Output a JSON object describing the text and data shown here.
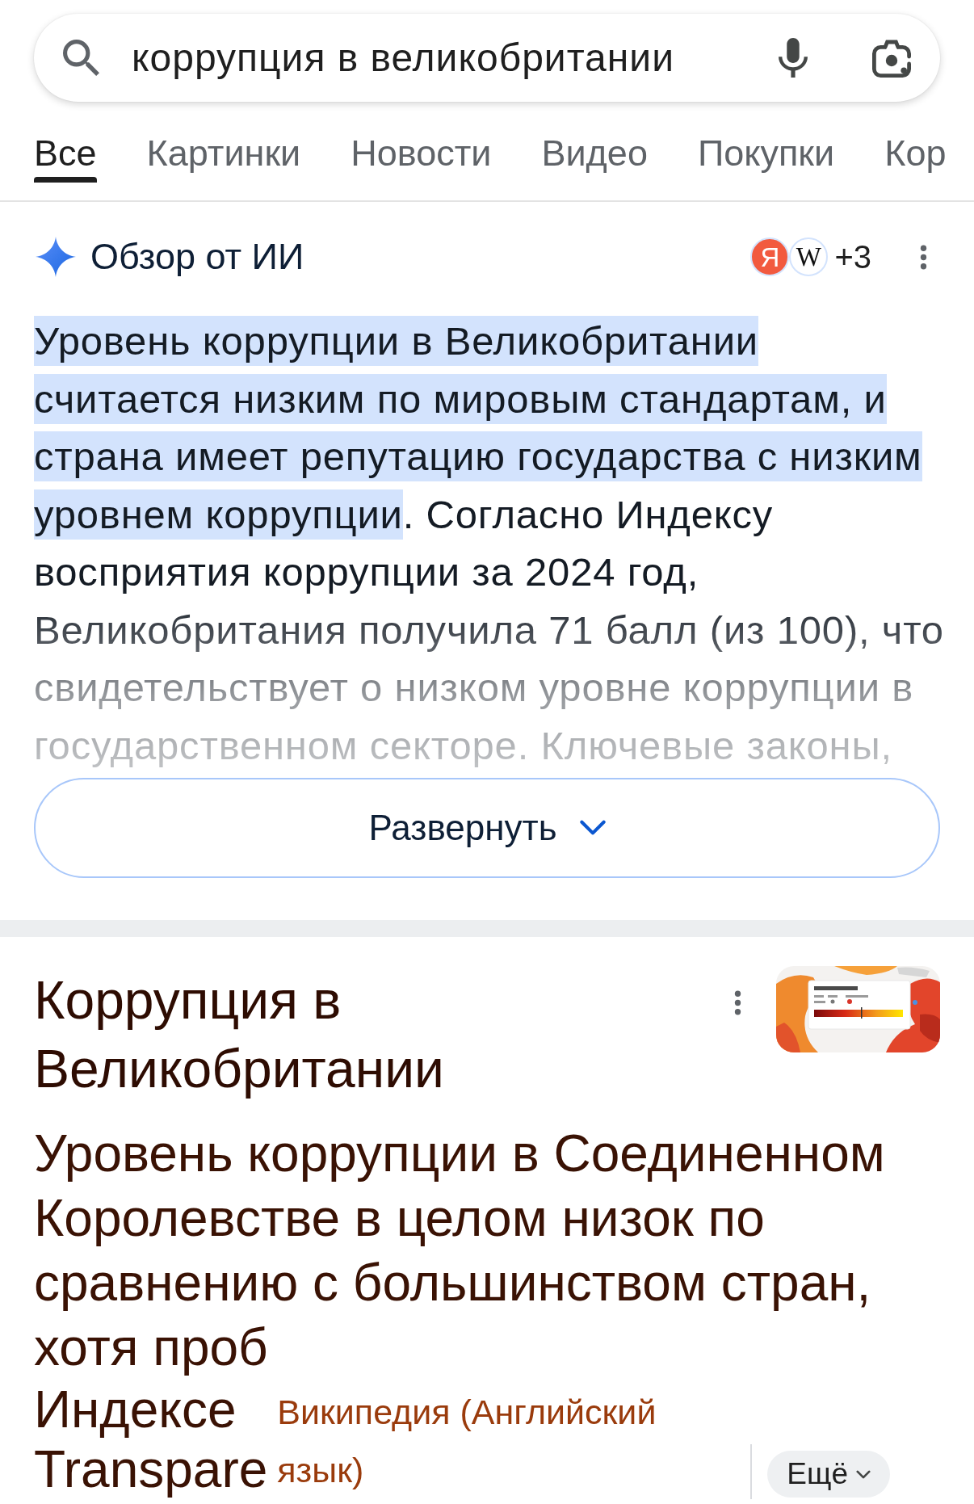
{
  "search": {
    "value": "коррупция в великобритании"
  },
  "tabs": [
    {
      "label": "Все",
      "selected": true
    },
    {
      "label": "Картинки",
      "selected": false
    },
    {
      "label": "Новости",
      "selected": false
    },
    {
      "label": "Видео",
      "selected": false
    },
    {
      "label": "Покупки",
      "selected": false
    },
    {
      "label": "Кор",
      "selected": false
    }
  ],
  "ai_overview": {
    "title": "Обзор от ИИ",
    "sources": [
      {
        "kind": "sans",
        "glyph": "Я",
        "color": "#f25a3f"
      },
      {
        "kind": "serif",
        "glyph": "W",
        "color": "#ffffff"
      }
    ],
    "more_sources": "+3",
    "highlight": "Уровень коррупции в Великобритании считается низким по мировым стандартам, и страна имеет репутацию государства с низким уровнем коррупции",
    "text": ". Согласно Индексу восприятия коррупции за 2024 год, Великобритания получила 71 балл (из 100), что свидетельствует о низком уровне коррупции в государственном секторе. Ключевые законы,",
    "expand_button": "Развернуть"
  },
  "result": {
    "title": "Коррупция в Великобритании",
    "snippet": "Уровень коррупции в Соединенном Королевстве в целом низок по сравнению с большинством стран, хотя проб",
    "snippet_continuation": [
      "Индексе",
      "Transpare"
    ],
    "source": "Википедия (Английский язык)",
    "more_button": "Ещё"
  }
}
